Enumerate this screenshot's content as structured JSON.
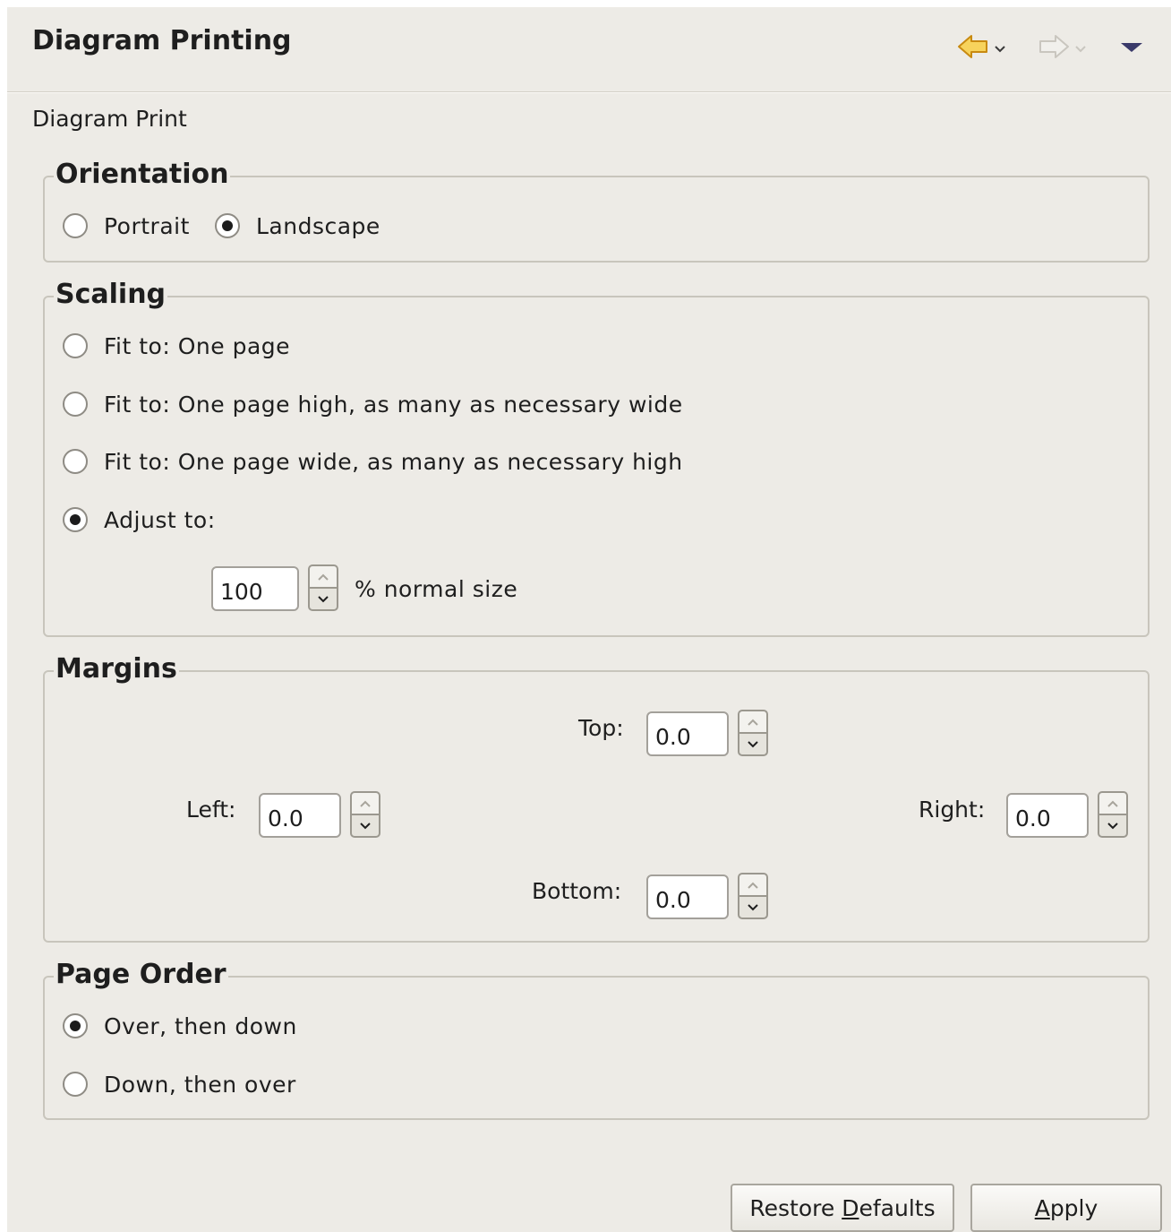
{
  "header": {
    "title": "Diagram Printing",
    "subtitle": "Diagram Print",
    "icons": [
      "back-arrow-icon",
      "chevron-down-icon",
      "forward-arrow-icon",
      "chevron-down-icon",
      "view-menu-icon"
    ]
  },
  "orientation": {
    "legend": "Orientation",
    "options": [
      {
        "label": "Portrait",
        "checked": false
      },
      {
        "label": "Landscape",
        "checked": true
      }
    ]
  },
  "scaling": {
    "legend": "Scaling",
    "options": [
      {
        "label": "Fit to: One page",
        "checked": false
      },
      {
        "label": "Fit to: One page high, as many as necessary wide",
        "checked": false
      },
      {
        "label": "Fit to: One page wide, as many as necessary high",
        "checked": false
      },
      {
        "label": "Adjust to:",
        "checked": true
      }
    ],
    "percent_value": "100",
    "percent_suffix": "% normal size"
  },
  "margins": {
    "legend": "Margins",
    "top_label": "Top:",
    "top_value": "0.0",
    "left_label": "Left:",
    "left_value": "0.0",
    "right_label": "Right:",
    "right_value": "0.0",
    "bottom_label": "Bottom:",
    "bottom_value": "0.0"
  },
  "page_order": {
    "legend": "Page Order",
    "options": [
      {
        "label": "Over, then down",
        "checked": true
      },
      {
        "label": "Down, then over",
        "checked": false
      }
    ]
  },
  "buttons": {
    "restore_pre": "Restore ",
    "restore_mnemonic": "D",
    "restore_post": "efaults",
    "apply_mnemonic": "A",
    "apply_post": "pply"
  },
  "colors": {
    "panel_bg": "#edebe6",
    "back_arrow": "#e8b020",
    "forward_arrow_disabled": "#c9c6bf",
    "view_menu": "#3a3a6a"
  }
}
